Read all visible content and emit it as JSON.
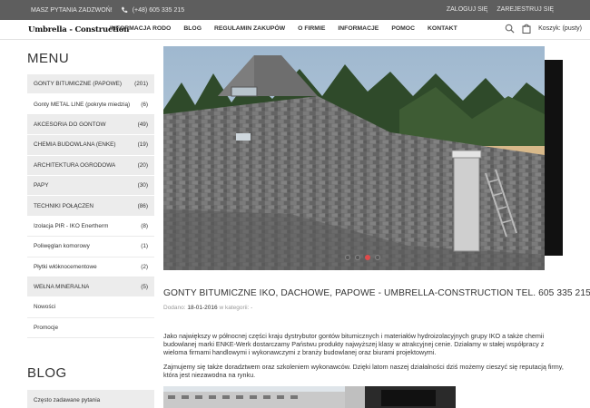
{
  "topbar": {
    "question": "MASZ PYTANIA ZADZWOŃ!",
    "phone": "(+48) 605 335 215",
    "login": "ZALOGUJ SIĘ",
    "register": "ZAREJESTRUJ SIĘ"
  },
  "navbar": {
    "logo": "Umbrella - Construction",
    "items": [
      "INFORMACJA RODO",
      "BLOG",
      "REGULAMIN ZAKUPÓW",
      "O FIRMIE",
      "INFORMACJE",
      "POMOC",
      "KONTAKT"
    ],
    "cart": "Koszyk: (pusty)"
  },
  "sidebar": {
    "menu_title": "MENU",
    "items": [
      {
        "label": "GONTY BITUMICZNE (PAPOWE)",
        "count": "(201)"
      },
      {
        "label": "Gonty METAL LINE (pokryte miedzią)",
        "count": "(6)"
      },
      {
        "label": "AKCESORIA DO GONTÓW",
        "count": "(49)"
      },
      {
        "label": "CHEMIA BUDOWLANA (ENKE)",
        "count": "(19)"
      },
      {
        "label": "ARCHITEKTURA OGRODOWA",
        "count": "(20)"
      },
      {
        "label": "PAPY",
        "count": "(30)"
      },
      {
        "label": "TECHNIKI POŁĄCZEŃ",
        "count": "(86)"
      },
      {
        "label": "Izolacja PIR - IKO Enertherm",
        "count": "(8)"
      },
      {
        "label": "Poliwęglan komorowy",
        "count": "(1)"
      },
      {
        "label": "Płytki włóknocementowe",
        "count": "(2)"
      },
      {
        "label": "WEŁNA MINERALNA",
        "count": "(5)"
      },
      {
        "label": "Nowości",
        "count": ""
      },
      {
        "label": "Promocje",
        "count": ""
      }
    ],
    "blog_title": "BLOG",
    "blog_items": [
      "Często zadawane pytania"
    ]
  },
  "slider": {
    "dots": [
      false,
      false,
      true,
      false
    ]
  },
  "article": {
    "title": "GONTY BITUMICZNE IKO, DACHOWE, PAPOWE - UMBRELLA-CONSTRUCTION TEL. 605 335 215",
    "meta_prefix": "Dodano:",
    "date": "18-01-2016",
    "meta_suffix": "w kategorii: -",
    "paragraph1": "Jako największy w północnej części kraju dystrybutor gontów bitumicznych i materiałów hydroizolacyjnych grupy IKO a także chemii budowlanej marki ENKE-Werk dostarczamy Państwu produkty najwyższej klasy w atrakcyjnej cenie. Działamy w stałej współpracy z wieloma firmami handlowymi i wykonawczymi z branży budowlanej oraz biurami projektowymi.",
    "paragraph2": "Zajmujemy się także doradztwem oraz szkoleniem wykonawców. Dzięki latom naszej działalności dziś możemy cieszyć się reputacją firmy, która jest niezawodna na rynku."
  },
  "colors": {
    "topbar_bg": "#5e5e5e",
    "accent": "#e04a4a",
    "menu_bg": "#ececec"
  }
}
